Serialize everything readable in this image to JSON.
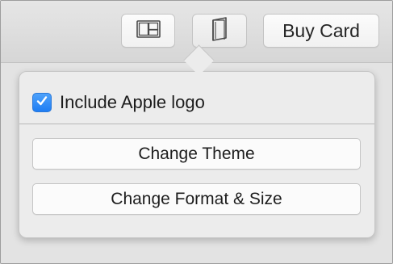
{
  "toolbar": {
    "layout_button_icon": "two-pane-layout-icon",
    "format_button_icon": "folded-card-icon",
    "buy_label": "Buy Card"
  },
  "popover": {
    "include_logo": {
      "label": "Include Apple logo",
      "checked": true,
      "check_color": "#1f7df3"
    },
    "buttons": [
      {
        "label": "Change Theme"
      },
      {
        "label": "Change Format & Size"
      }
    ]
  }
}
